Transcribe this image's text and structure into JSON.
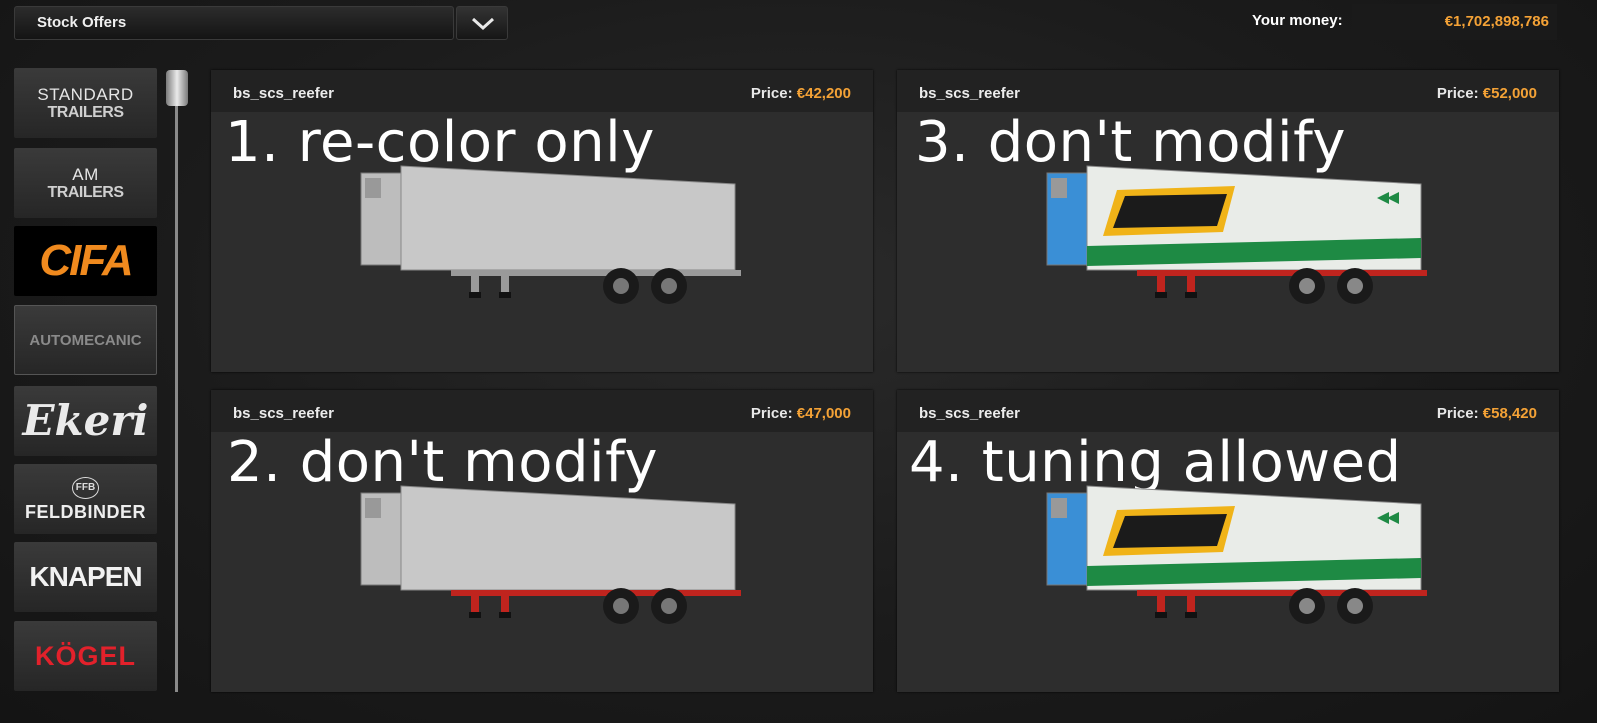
{
  "top_bar": {
    "dropdown_value": "Stock Offers",
    "money_label": "Your money:",
    "money_value": "€1,702,898,786"
  },
  "sidebar": {
    "brands": [
      {
        "line1": "STANDARD",
        "line2": "TRAILERS"
      },
      {
        "line1": "AM",
        "line2": "TRAILERS"
      },
      {
        "text": "CIFA"
      },
      {
        "text": "AUTOMECANIC"
      },
      {
        "text": "Ekeri"
      },
      {
        "text": "FELDBINDER"
      },
      {
        "text": "KNAPEN"
      },
      {
        "text": "KÖGEL"
      }
    ]
  },
  "offers": [
    {
      "name": "bs_scs_reefer",
      "price_label": "Price:",
      "price": "€42,200",
      "overlay": "1. re-color only",
      "livery": "plain",
      "chassis_color": "#9a9a9a"
    },
    {
      "name": "bs_scs_reefer",
      "price_label": "Price:",
      "price": "€52,000",
      "overlay": "3. don't modify",
      "livery": "ittia",
      "chassis_color": "#c0241e"
    },
    {
      "name": "bs_scs_reefer",
      "price_label": "Price:",
      "price": "€47,000",
      "overlay": "2. don't modify",
      "livery": "plain",
      "chassis_color": "#c0241e"
    },
    {
      "name": "bs_scs_reefer",
      "price_label": "Price:",
      "price": "€58,420",
      "overlay": "4. tuning allowed",
      "livery": "ittia",
      "chassis_color": "#c0241e"
    }
  ],
  "colors": {
    "accent_price": "#f4a236",
    "card_bg": "#2d2d2d",
    "card_header_bg": "#222222"
  }
}
